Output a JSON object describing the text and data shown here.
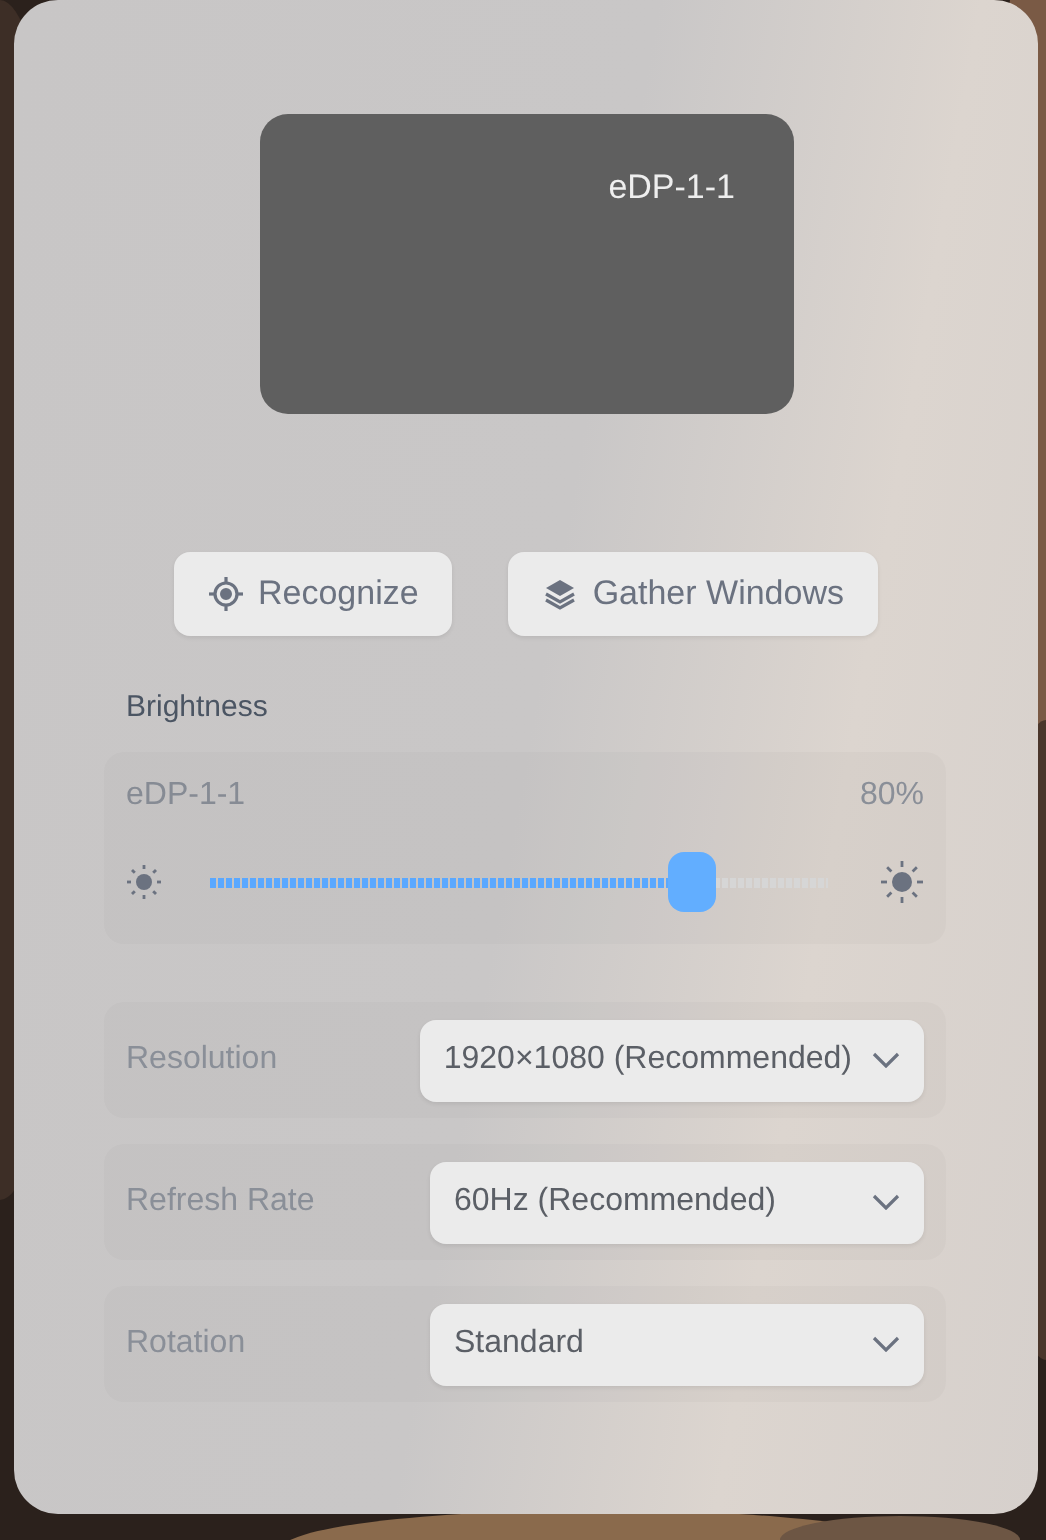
{
  "display": {
    "name": "eDP-1-1"
  },
  "buttons": [
    {
      "kind": "recognize",
      "label": "Recognize"
    },
    {
      "kind": "gather",
      "label": "Gather Windows"
    }
  ],
  "brightness": {
    "title": "Brightness",
    "monitor": "eDP-1-1",
    "reading": "80%",
    "level": 0.8
  },
  "settings": [
    {
      "label": "Resolution",
      "value": "1920×1080 (Recommended)"
    },
    {
      "label": "Refresh Rate",
      "value": "60Hz (Recommended)"
    },
    {
      "label": "Rotation",
      "value": "Standard"
    }
  ]
}
